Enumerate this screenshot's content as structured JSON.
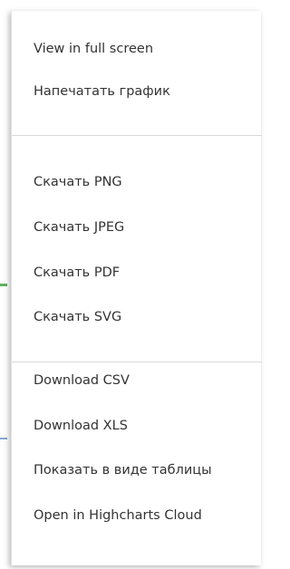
{
  "menu": {
    "items": [
      {
        "label": "View in full screen"
      },
      {
        "label": "Напечатать график"
      },
      {
        "label": "Скачать PNG"
      },
      {
        "label": "Скачать JPEG"
      },
      {
        "label": "Скачать PDF"
      },
      {
        "label": "Скачать SVG"
      },
      {
        "label": "Download CSV"
      },
      {
        "label": "Download XLS"
      },
      {
        "label": "Показать в виде таблицы"
      },
      {
        "label": "Open in Highcharts Cloud"
      }
    ]
  }
}
